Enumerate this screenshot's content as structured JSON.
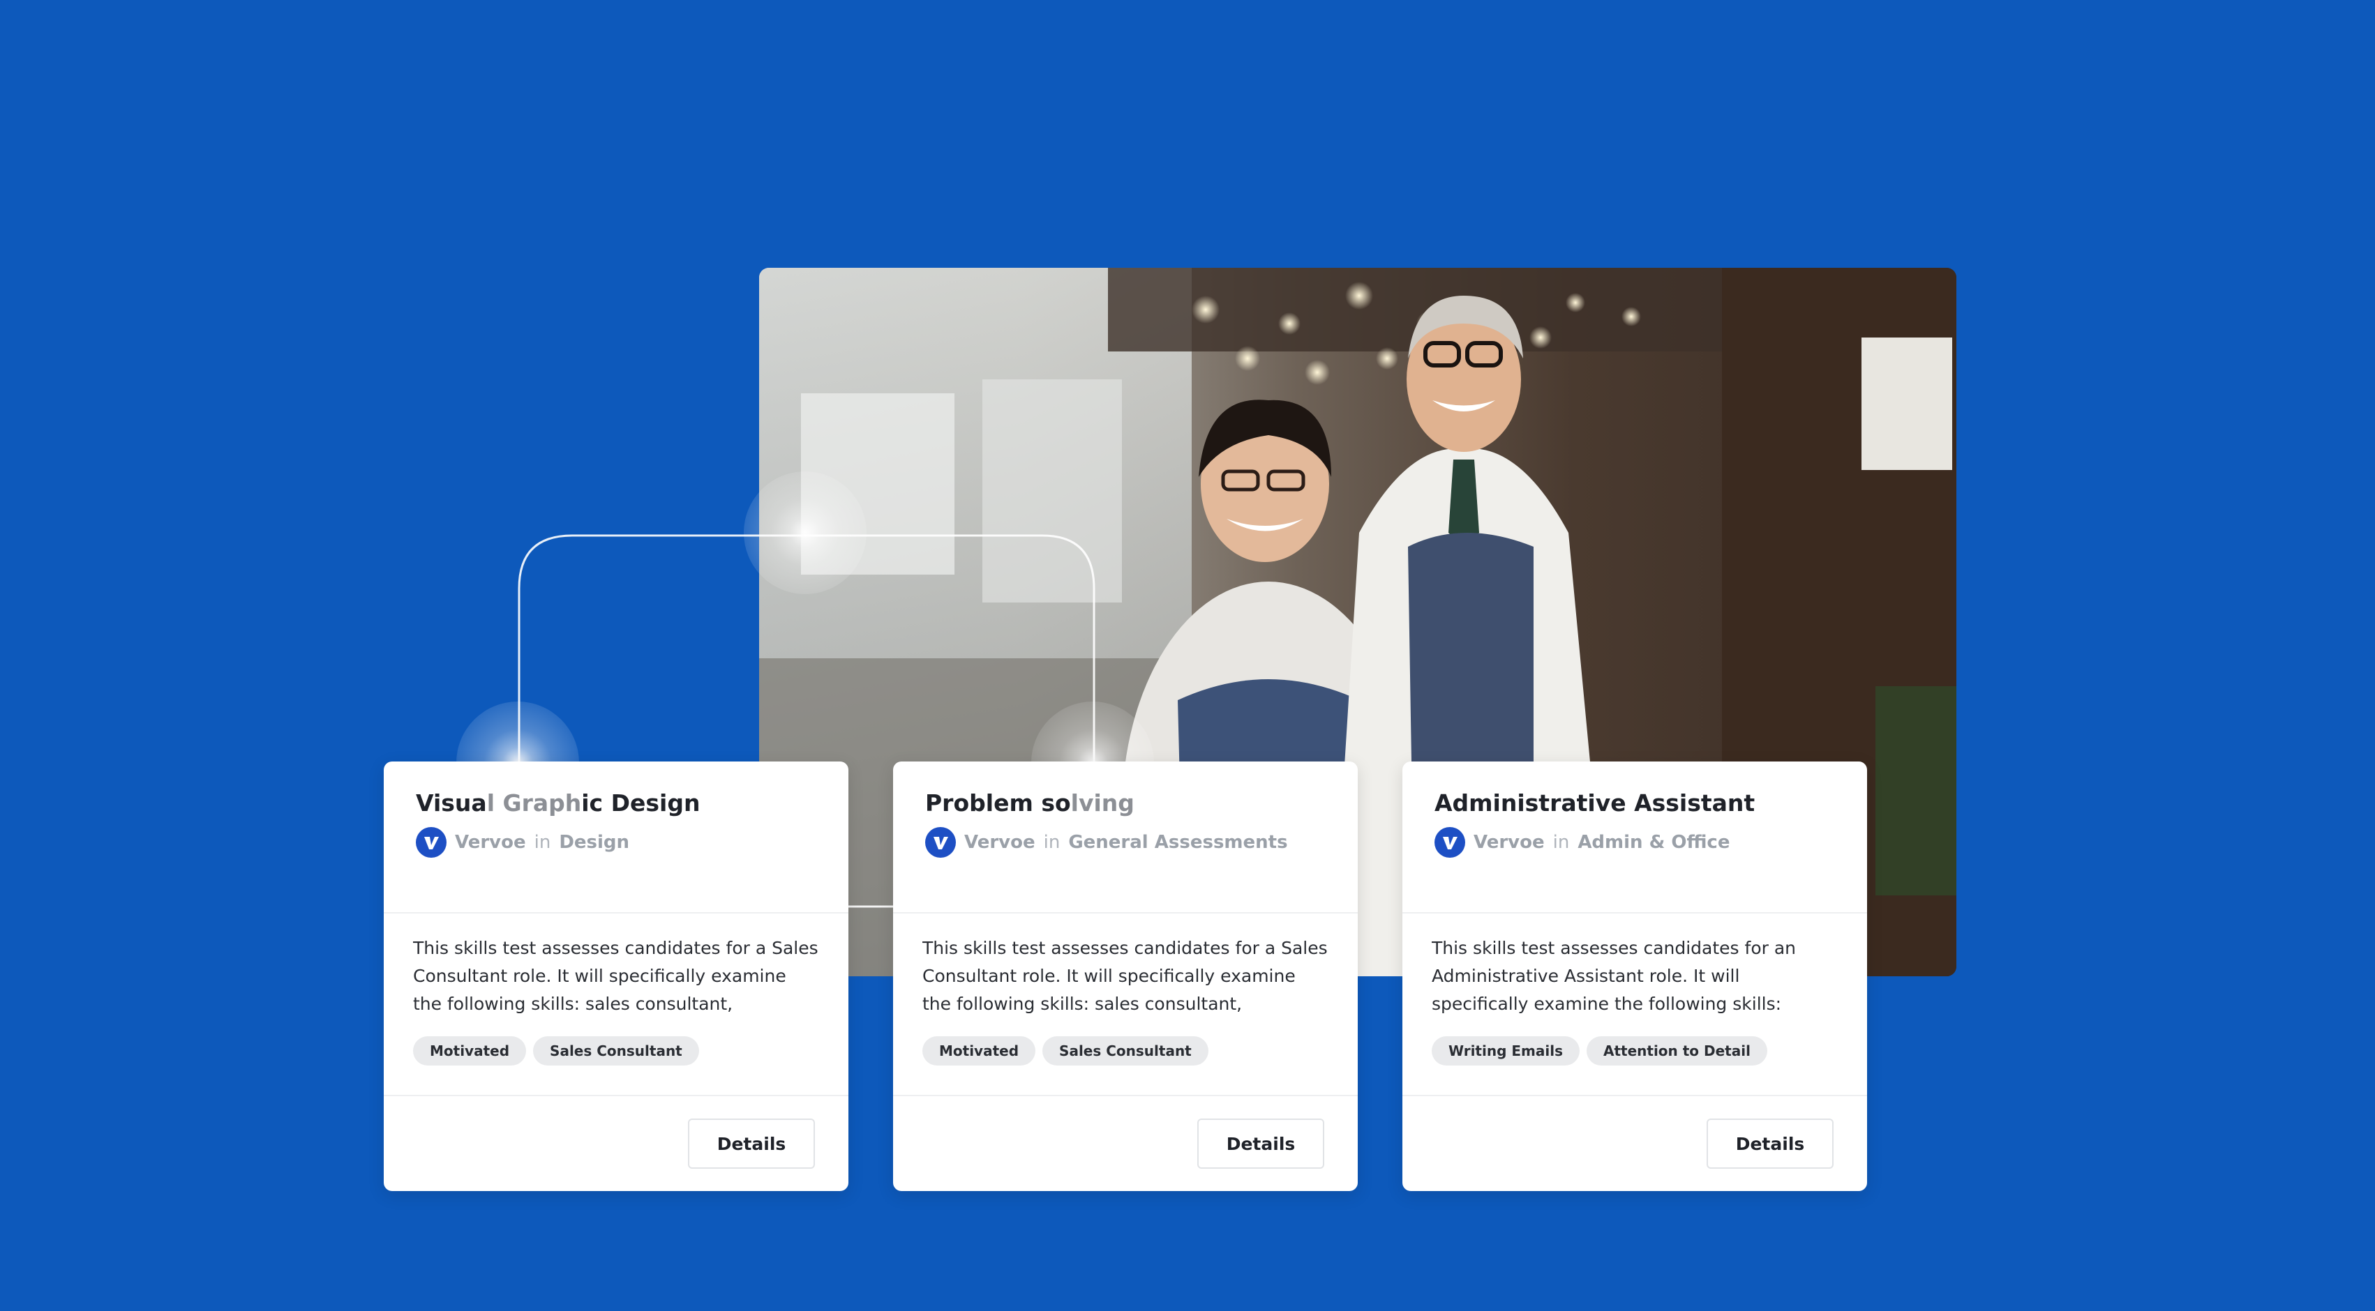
{
  "cards": [
    {
      "title_parts": [
        "Visua",
        "l Graph",
        "ic Design"
      ],
      "company": "Vervoe",
      "in_word": "in",
      "category": "Design",
      "description": "This skills test assesses candidates for a Sales Consultant role. It will specifically examine the following skills: sales consultant, motivati...",
      "tags": [
        "Motivated",
        "Sales Consultant"
      ],
      "button": "Details"
    },
    {
      "title_parts": [
        "Problem so",
        "lving",
        ""
      ],
      "company": "Vervoe",
      "in_word": "in",
      "category": "General Assessments",
      "description": "This skills test assesses candidates for a Sales Consultant role. It will specifically examine the following skills: sales consultant, motivati...",
      "tags": [
        "Motivated",
        "Sales Consultant"
      ],
      "button": "Details"
    },
    {
      "title_parts": [
        "Administrative Assistant",
        "",
        ""
      ],
      "company": "Vervoe",
      "in_word": "in",
      "category": "Admin & Office",
      "description": "This skills test assesses candidates for an Administrative Assistant role. It will specifically examine the following skills: admin assistant...",
      "tags": [
        "Writing Emails",
        "Attention to Detail"
      ],
      "button": "Details"
    }
  ],
  "colors": {
    "background": "#0d59bb",
    "logo": "#1d4fc4",
    "card": "#ffffff",
    "tag_bg": "#e9eaec"
  },
  "icons": {
    "company_logo": "vervoe-logo-icon"
  }
}
